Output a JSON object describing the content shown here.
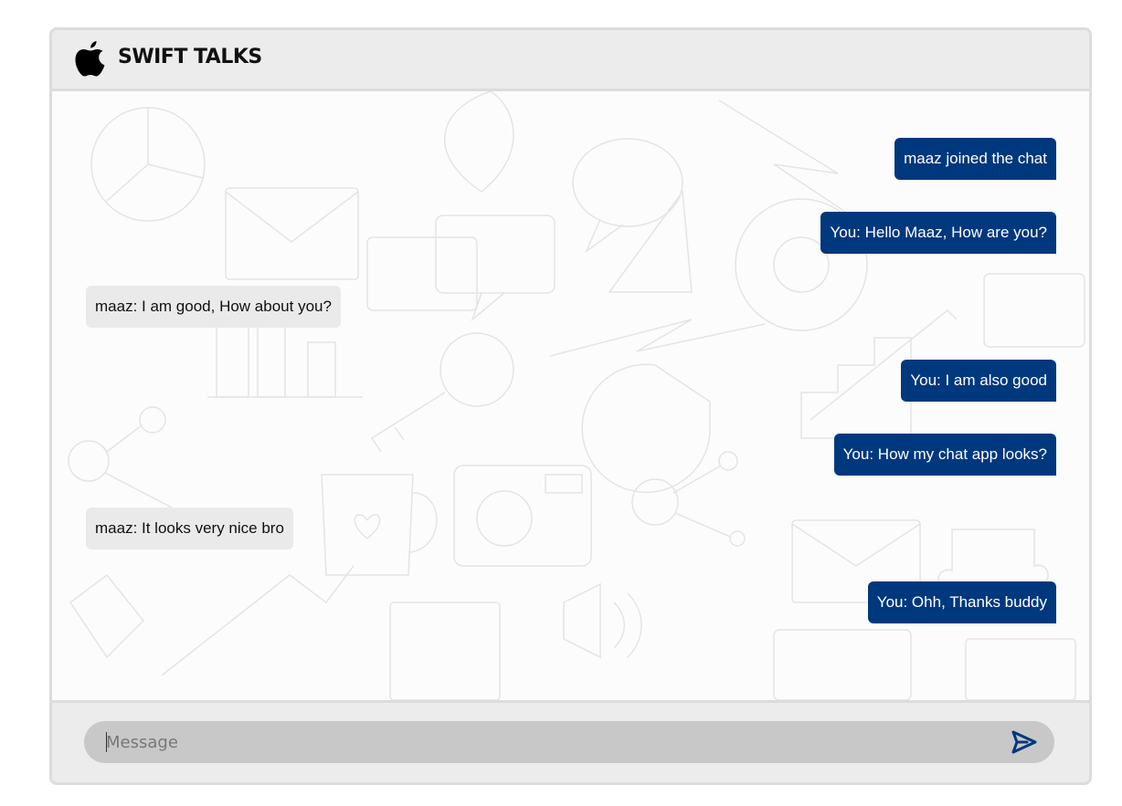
{
  "app": {
    "brand": "SWIFT TALKS",
    "logo_icon": "apple-logo-icon"
  },
  "colors": {
    "accent": "#00387e",
    "incoming_bubble": "#eaeaea",
    "frame": "#ececec",
    "input_bg": "#c8c8c8"
  },
  "messages": [
    {
      "direction": "out",
      "text": "maaz joined the chat"
    },
    {
      "direction": "out",
      "text": "You: Hello Maaz, How are you?"
    },
    {
      "direction": "in",
      "text": "maaz: I am good, How about you?"
    },
    {
      "direction": "out",
      "text": "You: I am also good"
    },
    {
      "direction": "out",
      "text": "You: How my chat app looks?"
    },
    {
      "direction": "in",
      "text": "maaz: It looks very nice bro"
    },
    {
      "direction": "out",
      "text": "You: Ohh, Thanks buddy"
    }
  ],
  "composer": {
    "placeholder": "Message",
    "value": "",
    "send_icon": "send-icon"
  }
}
